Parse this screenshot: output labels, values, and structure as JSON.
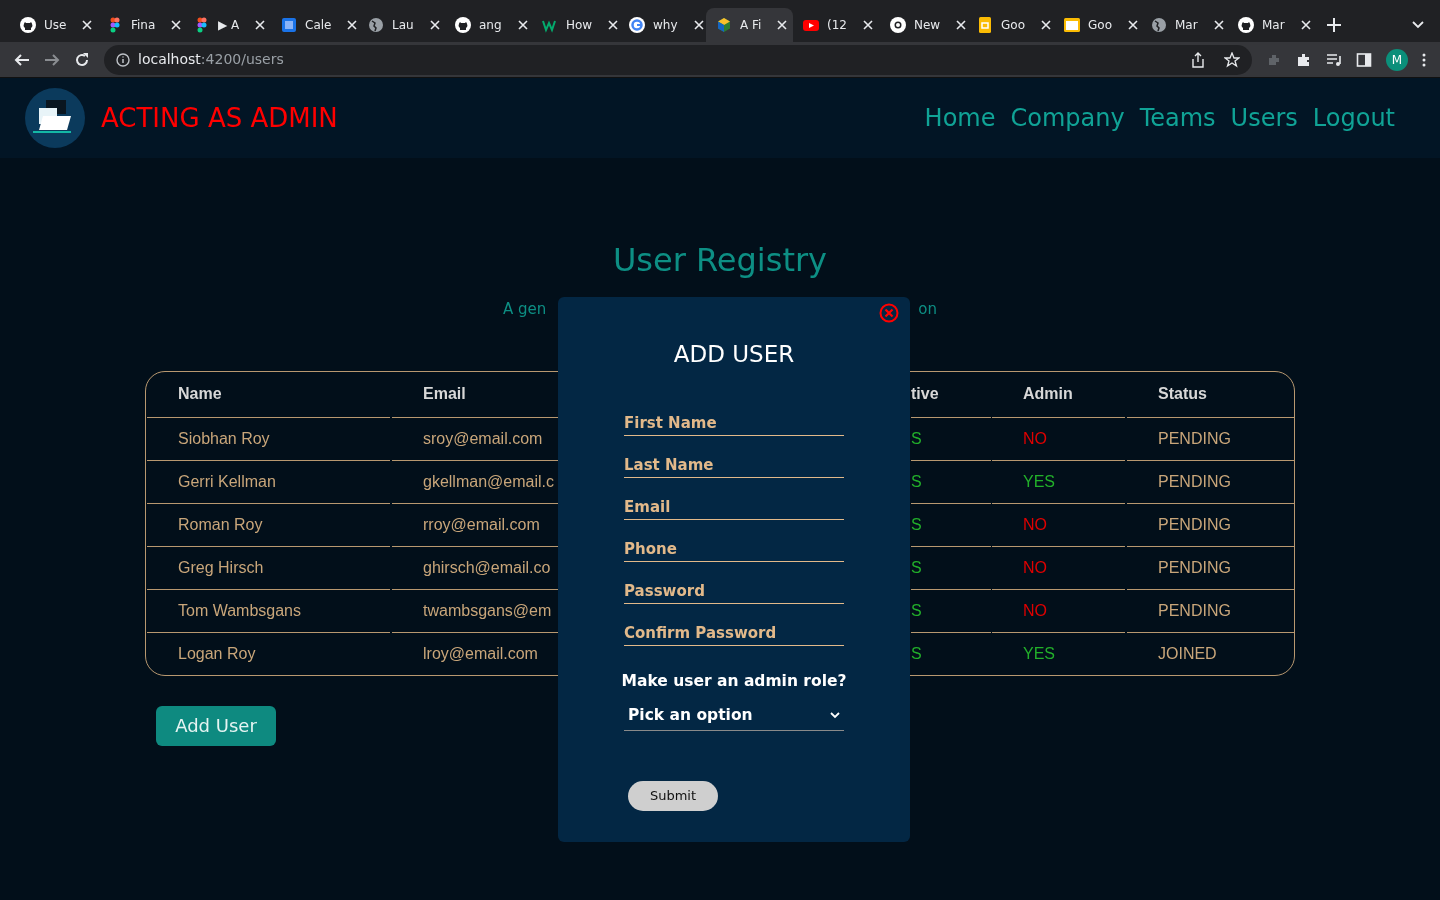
{
  "browser": {
    "tabs": [
      {
        "kind": "github",
        "title": "Use",
        "selected": false
      },
      {
        "kind": "figma",
        "title": "Fina",
        "selected": false
      },
      {
        "kind": "figma",
        "title": "▶ A",
        "selected": false
      },
      {
        "kind": "calendar",
        "title": "Cale",
        "selected": false
      },
      {
        "kind": "globe",
        "title": "Lau",
        "selected": false
      },
      {
        "kind": "github",
        "title": "ang",
        "selected": false
      },
      {
        "kind": "w3",
        "title": "How",
        "selected": false
      },
      {
        "kind": "google",
        "title": "why",
        "selected": false
      },
      {
        "kind": "stack",
        "title": "A Fi",
        "selected": true
      },
      {
        "kind": "youtube",
        "title": "(12",
        "selected": false
      },
      {
        "kind": "chrome",
        "title": "New",
        "selected": false
      },
      {
        "kind": "slides",
        "title": "Goo",
        "selected": false
      },
      {
        "kind": "sheets",
        "title": "Goo",
        "selected": false
      },
      {
        "kind": "globe",
        "title": "Mar",
        "selected": false
      },
      {
        "kind": "github",
        "title": "Mar",
        "selected": false
      }
    ],
    "url": {
      "host": "localhost",
      "path": ":4200/users"
    },
    "profile": "M"
  },
  "header": {
    "title": "ACTING AS ADMIN",
    "nav": [
      "Home",
      "Company",
      "Teams",
      "Users",
      "Logout"
    ]
  },
  "page": {
    "title": "User Registry",
    "subtitle_left": "A gen",
    "subtitle_right": "on",
    "table": {
      "columns": [
        "Name",
        "Email",
        "tive",
        "Admin",
        "Status"
      ],
      "rows": [
        {
          "name": "Siobhan Roy",
          "email": "sroy@email.com",
          "column_3": "S",
          "admin": {
            "text": "NO",
            "on": false
          },
          "status": "PENDING"
        },
        {
          "name": "Gerri Kellman",
          "email": "gkellman@email.c",
          "column_3": "S",
          "admin": {
            "text": "YES",
            "on": true
          },
          "status": "PENDING"
        },
        {
          "name": "Roman Roy",
          "email": "rroy@email.com",
          "column_3": "S",
          "admin": {
            "text": "NO",
            "on": false
          },
          "status": "PENDING"
        },
        {
          "name": "Greg Hirsch",
          "email": "ghirsch@email.co",
          "column_3": "S",
          "admin": {
            "text": "NO",
            "on": false
          },
          "status": "PENDING"
        },
        {
          "name": "Tom Wambsgans",
          "email": "twambsgans@em",
          "column_3": "S",
          "admin": {
            "text": "NO",
            "on": false
          },
          "status": "PENDING"
        },
        {
          "name": "Logan Roy",
          "email": "lroy@email.com",
          "column_3": "S",
          "admin": {
            "text": "YES",
            "on": true
          },
          "status": "JOINED"
        }
      ]
    },
    "add_button": "Add User"
  },
  "modal": {
    "title": "ADD USER",
    "fields": [
      {
        "placeholder": "First Name"
      },
      {
        "placeholder": "Last Name"
      },
      {
        "placeholder": "Email"
      },
      {
        "placeholder": "Phone"
      },
      {
        "placeholder": "Password"
      },
      {
        "placeholder": "Confirm Password"
      }
    ],
    "admin_question": "Make user an admin role?",
    "select": {
      "placeholder": "Pick an option"
    },
    "submit": "Submit"
  }
}
